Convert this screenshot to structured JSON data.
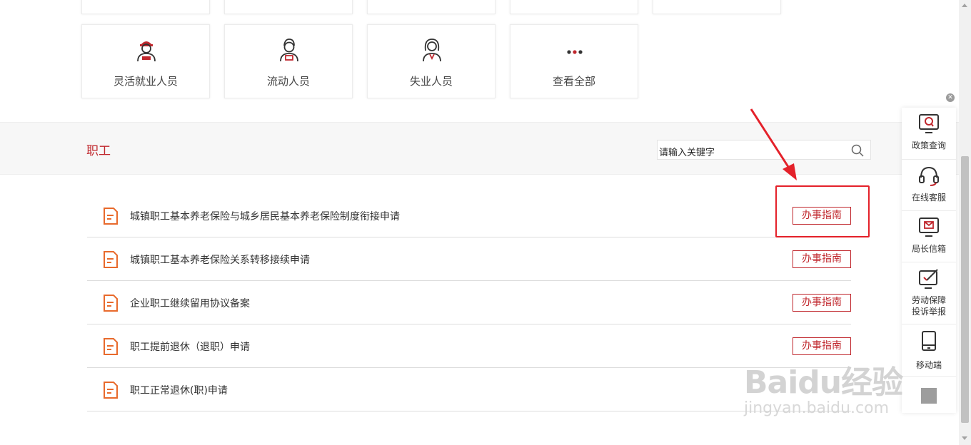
{
  "categories": [
    {
      "name": "flexible-workers",
      "label": "灵活就业人员",
      "icon": "worker-cap-icon"
    },
    {
      "name": "migrant-workers",
      "label": "流动人员",
      "icon": "worker-icon"
    },
    {
      "name": "unemployed",
      "label": "失业人员",
      "icon": "woman-icon"
    },
    {
      "name": "view-all",
      "label": "查看全部",
      "icon": "more-dots-icon"
    }
  ],
  "section": {
    "title": "职工"
  },
  "search": {
    "placeholder": "请输入关键字"
  },
  "services": [
    {
      "title": "城镇职工基本养老保险与城乡居民基本养老保险制度衔接申请",
      "button": "办事指南"
    },
    {
      "title": "城镇职工基本养老保险关系转移接续申请",
      "button": "办事指南"
    },
    {
      "title": "企业职工继续留用协议备案",
      "button": "办事指南"
    },
    {
      "title": "职工提前退休（退职）申请",
      "button": "办事指南"
    },
    {
      "title": "职工正常退休(职)申请",
      "button": ""
    }
  ],
  "sidebar": [
    {
      "label": "政策查询",
      "icon": "policy-search-icon"
    },
    {
      "label": "在线客服",
      "icon": "headset-icon"
    },
    {
      "label": "局长信箱",
      "icon": "mailbox-icon"
    },
    {
      "label": "劳动保障投诉举报",
      "label_line1": "劳动保障",
      "label_line2": "投诉举报",
      "icon": "complaint-icon"
    },
    {
      "label": "移动端",
      "icon": "mobile-icon"
    }
  ],
  "watermark": {
    "brand": "Baidu经验",
    "url": "jingyan.baidu.com"
  },
  "colors": {
    "accent": "#c0272d",
    "icon_orange": "#e86a2c",
    "highlight": "#e4212a"
  }
}
